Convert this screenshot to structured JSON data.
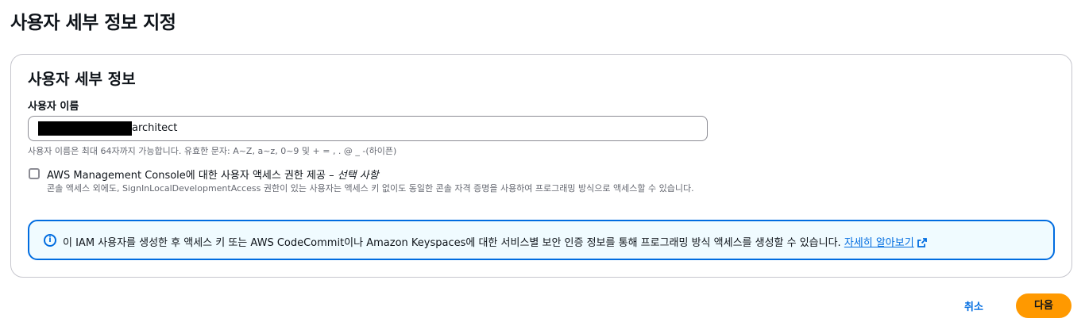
{
  "page": {
    "title": "사용자 세부 정보 지정"
  },
  "section": {
    "title": "사용자 세부 정보",
    "username": {
      "label": "사용자 이름",
      "value_suffix": "architect",
      "constraint": "사용자 이름은 최대 64자까지 가능합니다. 유효한 문자: A~Z, a~z, 0~9 및 + = , . @ _ -(하이픈)"
    },
    "console_access": {
      "label": "AWS Management Console에 대한 사용자 액세스 권한 제공 – ",
      "optional": "선택 사항",
      "checked": false,
      "description": "콘솔 액세스 외에도, SignInLocalDevelopmentAccess 권한이 있는 사용자는 액세스 키 없이도 동일한 콘솔 자격 증명을 사용하여 프로그래밍 방식으로 액세스할 수 있습니다."
    },
    "info": {
      "text": "이 IAM 사용자를 생성한 후 액세스 키 또는 AWS CodeCommit이나 Amazon Keyspaces에 대한 서비스별 보안 인증 정보를 통해 프로그래밍 방식 액세스를 생성할 수 있습니다. ",
      "link": "자세히 알아보기"
    }
  },
  "actions": {
    "cancel": "취소",
    "next": "다음"
  },
  "colors": {
    "primary_button": "#ff9900",
    "link": "#006ce0",
    "info_border": "#006ce0"
  }
}
